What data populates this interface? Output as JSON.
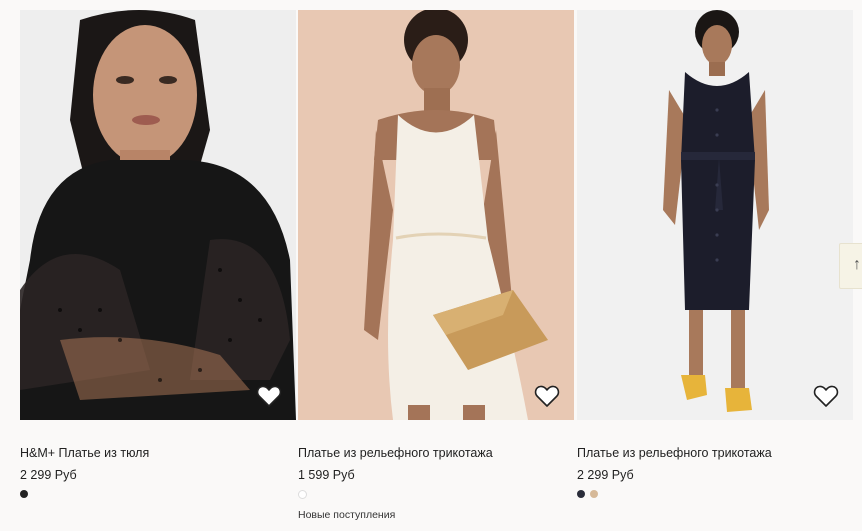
{
  "products": [
    {
      "name": "H&M+ Платье из тюля",
      "price": "2 299 Руб",
      "bg": "#efefef",
      "swatches": [
        "#222222"
      ],
      "badge": ""
    },
    {
      "name": "Платье из рельефного трикотажа",
      "price": "1 599 Руб",
      "bg": "#e6c7b2",
      "swatches": [
        "#ffffff"
      ],
      "badge": "Новые поступления"
    },
    {
      "name": "Платье из рельефного трикотажа",
      "price": "2 299 Руб",
      "bg": "#f2f2f2",
      "swatches": [
        "#2a2d3a",
        "#d6b998"
      ],
      "badge": ""
    }
  ],
  "icons": {
    "favorite": "heart-outline-icon",
    "carousel_next": "arrow-icon"
  }
}
